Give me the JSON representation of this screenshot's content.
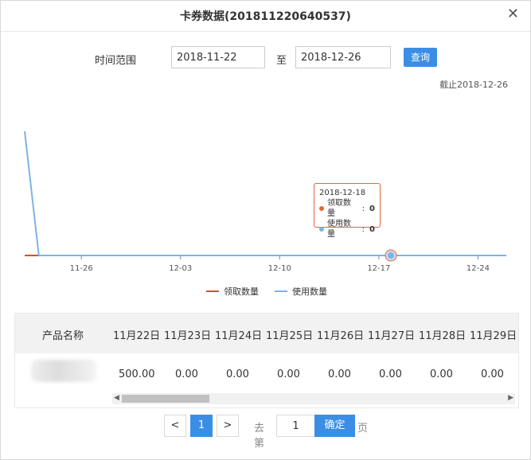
{
  "dialog": {
    "title": "卡券数据(201811220640537)",
    "close_icon": "close-icon"
  },
  "filter": {
    "label": "时间范围",
    "start_date": "2018-11-22",
    "to_label": "至",
    "end_date": "2018-12-26",
    "query_button": "查询",
    "as_of": "截止2018-12-26"
  },
  "chart_data": {
    "type": "line",
    "x_ticks": [
      "11-26",
      "12-03",
      "12-10",
      "12-17",
      "12-24"
    ],
    "x_range": [
      "2018-11-22",
      "2018-12-26"
    ],
    "series": [
      {
        "name": "领取数量",
        "color": "#d9531e",
        "points": [
          [
            "2018-11-22",
            0
          ],
          [
            "2018-12-26",
            0
          ]
        ]
      },
      {
        "name": "使用数量",
        "color": "#7fb2e5",
        "points": [
          [
            "2018-11-22",
            500
          ],
          [
            "2018-11-23",
            0
          ],
          [
            "2018-12-26",
            0
          ]
        ]
      }
    ],
    "legend": "bottom-center",
    "tooltip": {
      "date": "2018-12-18",
      "rows": [
        {
          "name": "领取数量",
          "value": "0",
          "color": "#e4663b"
        },
        {
          "name": "使用数量",
          "value": "0",
          "color": "#7fb2e5"
        }
      ]
    }
  },
  "table": {
    "columns": [
      "产品名称",
      "11月22日",
      "11月23日",
      "11月24日",
      "11月25日",
      "11月26日",
      "11月27日",
      "11月28日",
      "11月29日"
    ],
    "rows": [
      [
        "",
        "500.00",
        "0.00",
        "0.00",
        "0.00",
        "0.00",
        "0.00",
        "0.00",
        "0.00"
      ]
    ]
  },
  "pagination": {
    "prev": "<",
    "current": "1",
    "next": ">",
    "goto_prefix": "去第",
    "goto_value": "1",
    "confirm": "确定",
    "goto_suffix": "页"
  },
  "colors": {
    "accent": "#3b8ee5",
    "receive_line": "#d9531e",
    "use_line": "#7fb2e5"
  }
}
